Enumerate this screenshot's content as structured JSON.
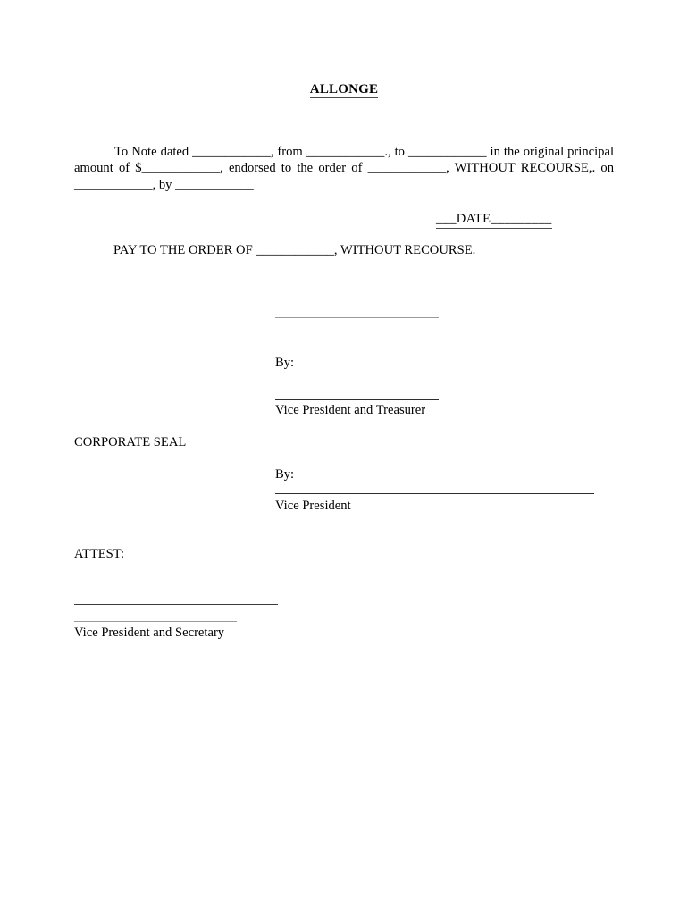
{
  "document": {
    "title": "ALLONGE",
    "body_paragraph": "To Note dated ____________, from ____________., to ____________ in the original principal amount of $____________, endorsed to the order of ____________, WITHOUT RECOURSE,. on ____________, by ____________",
    "date_line": "___DATE_________",
    "pay_to_order_line": "PAY TO THE ORDER OF ____________, WITHOUT RECOURSE.",
    "signature_block_1": {
      "by_label": "By:",
      "signer_title": "Vice President and Treasurer"
    },
    "signature_block_2": {
      "by_label": "By:",
      "signer_title": "Vice President"
    },
    "corporate_seal_label": "CORPORATE SEAL",
    "attest_label": "ATTEST:",
    "attest_signer_title": "Vice President and Secretary",
    "colors": {
      "text": "#000000",
      "rule_dark": "#2e2e2e",
      "rule_gray": "#9a9a9a",
      "page_background": "#ffffff"
    }
  }
}
